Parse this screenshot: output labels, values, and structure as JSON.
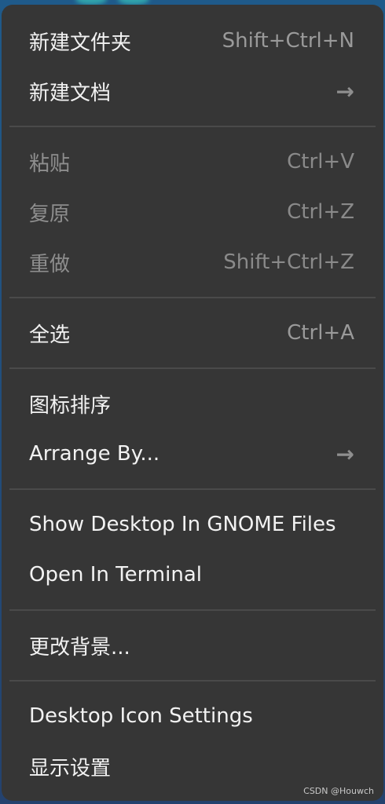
{
  "menu": {
    "items": [
      {
        "label": "新建文件夹",
        "shortcut": "Shift+Ctrl+N"
      },
      {
        "label": "新建文档",
        "submenu_icon": "arrow-right-icon"
      },
      {
        "label": "粘贴",
        "shortcut": "Ctrl+V",
        "enabled": false
      },
      {
        "label": "复原",
        "shortcut": "Ctrl+Z",
        "enabled": false
      },
      {
        "label": "重做",
        "shortcut": "Shift+Ctrl+Z",
        "enabled": false
      },
      {
        "label": "全选",
        "shortcut": "Ctrl+A"
      },
      {
        "label": "图标排序"
      },
      {
        "label": "Arrange By...",
        "submenu_icon": "arrow-right-icon"
      },
      {
        "label": "Show Desktop In GNOME Files"
      },
      {
        "label": "Open In Terminal"
      },
      {
        "label": "更改背景..."
      },
      {
        "label": "Desktop Icon Settings"
      },
      {
        "label": "显示设置"
      }
    ]
  },
  "watermark": "CSDN @Houwch",
  "colors": {
    "menu_bg": "#363636",
    "text": "#f2f2f2",
    "disabled_text": "#8e8e8e",
    "separator": "#4a4a4a"
  }
}
